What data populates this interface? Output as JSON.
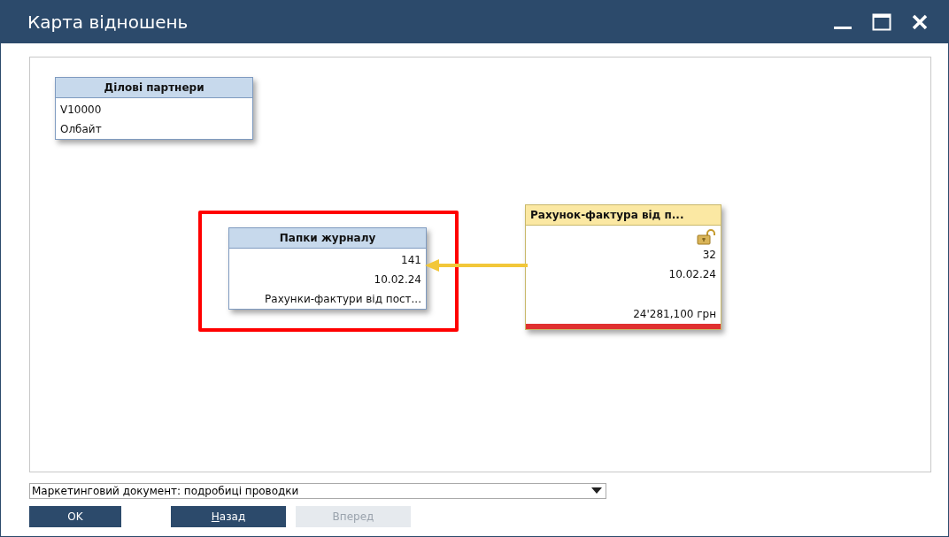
{
  "window": {
    "title": "Карта відношень"
  },
  "nodes": [
    {
      "kind": "partner",
      "title": "Ділові партнери",
      "lines": [
        "V10000",
        "Олбайт"
      ],
      "selected": false
    },
    {
      "kind": "journal",
      "title": "Папки журналу",
      "lines": [
        "141",
        "10.02.24",
        "Рахунки-фактури від пост..."
      ],
      "selected": true
    },
    {
      "kind": "invoice",
      "title": "Рахунок-фактура  від п...",
      "lines": [
        "32",
        "10.02.24"
      ],
      "total": "24'281,100 грн",
      "selected": false
    }
  ],
  "layout_select": {
    "value": "Маркетинговий документ: подробиці проводки"
  },
  "buttons": [
    {
      "label": "OK",
      "disabled": false
    },
    {
      "label": "Назад",
      "disabled": false
    },
    {
      "label": "Вперед",
      "disabled": true
    }
  ]
}
